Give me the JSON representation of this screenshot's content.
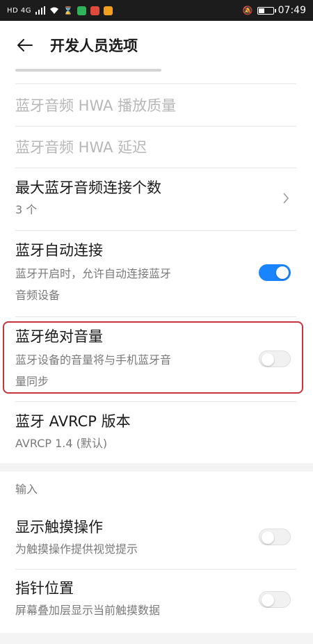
{
  "status_bar": {
    "left_text": "HD 4G",
    "time": "07:49",
    "chip_colors": [
      "#2fb25a",
      "#e04a3a",
      "#f2a020"
    ]
  },
  "header": {
    "title": "开发人员选项"
  },
  "items": {
    "hwa_quality": {
      "title": "蓝牙音频 HWA 播放质量"
    },
    "hwa_delay": {
      "title": "蓝牙音频 HWA 延迟"
    },
    "max_connections": {
      "title": "最大蓝牙音频连接个数",
      "value": "3 个"
    },
    "auto_connect": {
      "title": "蓝牙自动连接",
      "subtitle_line1": "蓝牙开启时，允许自动连接蓝牙",
      "subtitle_line2": "音频设备",
      "enabled": true
    },
    "absolute_volume": {
      "title": "蓝牙绝对音量",
      "subtitle_line1": "蓝牙设备的音量将与手机蓝牙音",
      "subtitle_line2": "量同步",
      "enabled": false
    },
    "avrcp_version": {
      "title": "蓝牙 AVRCP 版本",
      "value": "AVRCP 1.4 (默认)"
    }
  },
  "input_section": {
    "header": "输入",
    "show_taps": {
      "title": "显示触摸操作",
      "subtitle": "为触摸操作提供视觉提示",
      "enabled": false
    },
    "pointer_location": {
      "title": "指针位置",
      "subtitle": "屏幕叠加层显示当前触摸数据",
      "enabled": false
    }
  },
  "colors": {
    "toggle_on": "#1a84ff",
    "highlight_border": "#c8343e"
  }
}
